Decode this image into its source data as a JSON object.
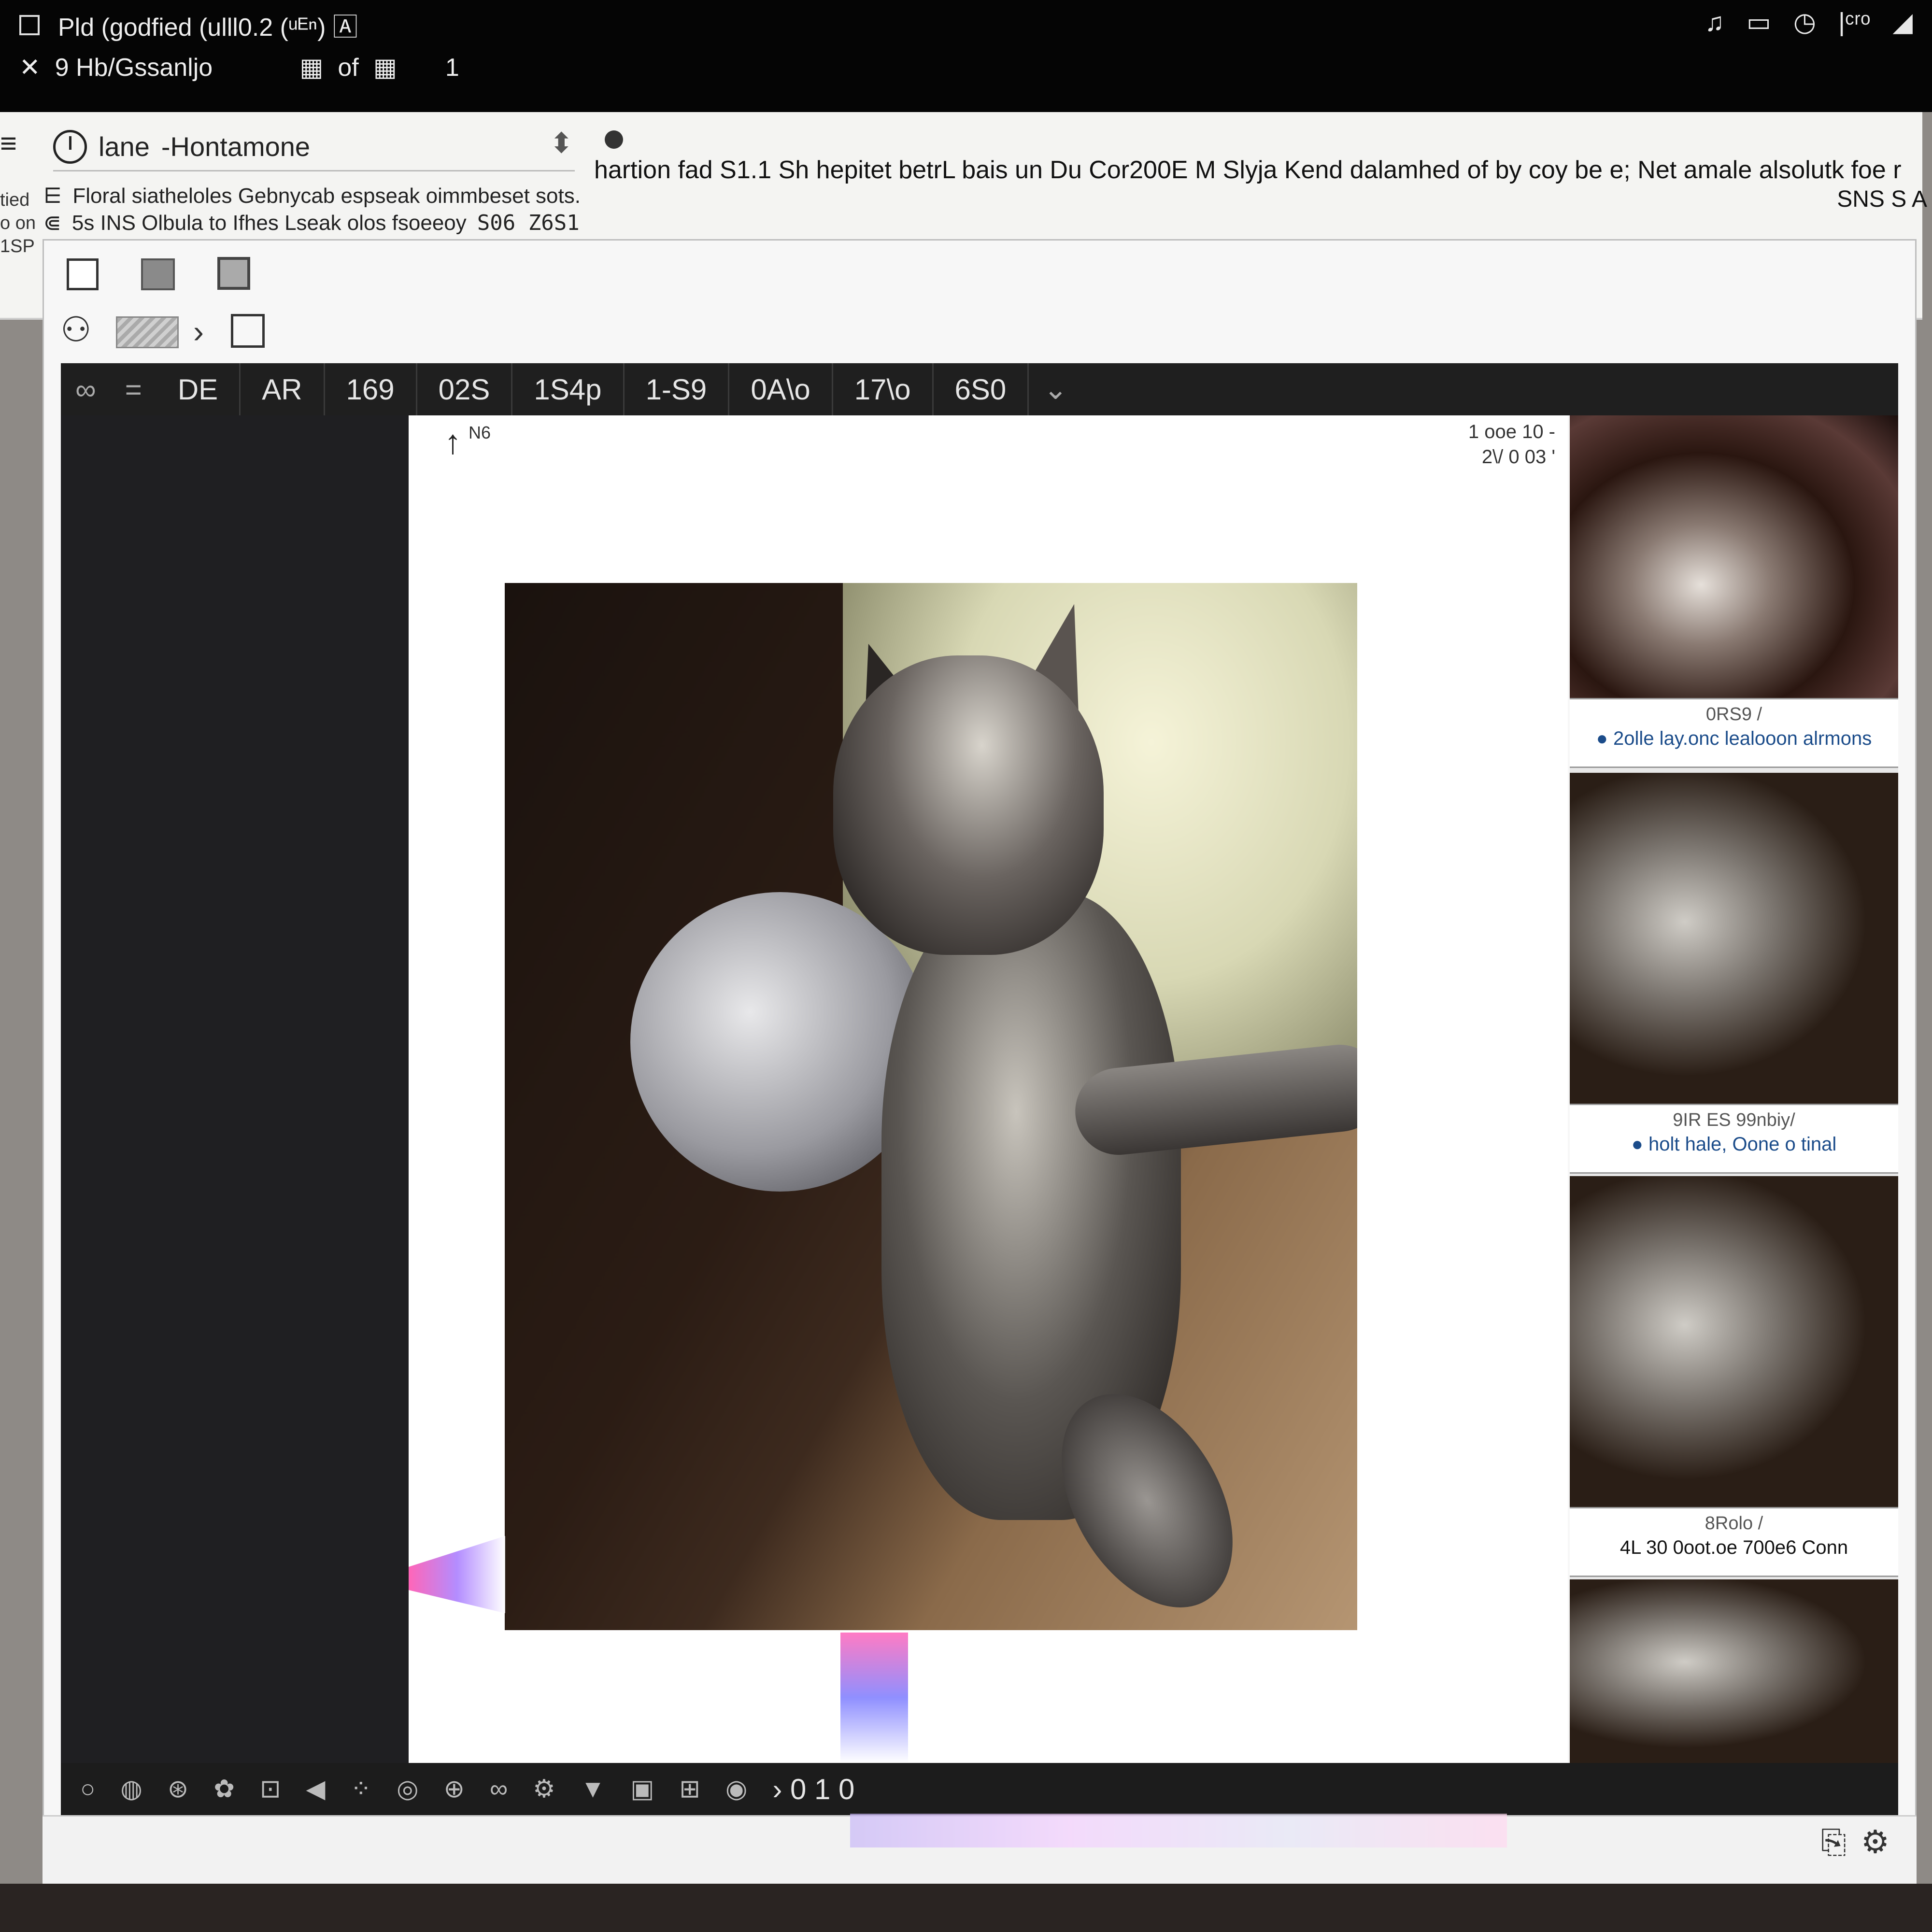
{
  "topbar": {
    "title": "Pld (godfied (ulll0.2  (ᵘᴱⁿ) 🄰",
    "path": "9 Hb/Gssanljo",
    "page_indicator": "of",
    "count": "1",
    "tray_icons": [
      "headset-icon",
      "battery-icon",
      "clock-icon",
      "wifi-icon",
      "signal-icon"
    ],
    "tray_text": "|ᶜʳᵒ"
  },
  "toolbar": {
    "location_label": "lane",
    "location_value": "-Hontamone",
    "headline": "hartion fad S1.1 Sh hepitet betrL bais un Du Cor200E M Slyja Kend dalamhed of by coy be e; Net amale alsolutk foe r",
    "headline_tail": "SNS S A",
    "info_line_1": "Floral siatheloles Gebnycab espseak oimmbeset sots.",
    "info_line_2": "5s INS Olbula to Ifhes Lseak olos fsoeeoy",
    "info_value": "S06 Z6S1",
    "side_clip": [
      "tied",
      "o on",
      "1SP"
    ]
  },
  "tabs": [
    "DE",
    "AR",
    "169",
    "02S",
    "1S4p",
    "1-S9",
    "0A\\o",
    "17\\o",
    "6S0"
  ],
  "canvas": {
    "arrow_label": "N6",
    "meta_1": "1 ooe 10 -",
    "meta_2": "2\\/ 0 03 '"
  },
  "thumbnails": [
    {
      "caption_1": "0RS9 /",
      "caption_2": "● 2olle lay.onc lealooon alrmons"
    },
    {
      "caption_1": "9IR ES 99nbiy/",
      "caption_2": "● holt hale,  Oone o tinal"
    },
    {
      "caption_1": "8Rolo /",
      "caption_2": "4L 30 0oot.oe 700e6 Conn"
    }
  ],
  "bottom_toolbar": {
    "counter": "› 0 1 0"
  },
  "colors": {
    "topbar_bg": "#050505",
    "tab_strip_bg": "#1f1f1f",
    "caption_link": "#1b4c8a"
  }
}
